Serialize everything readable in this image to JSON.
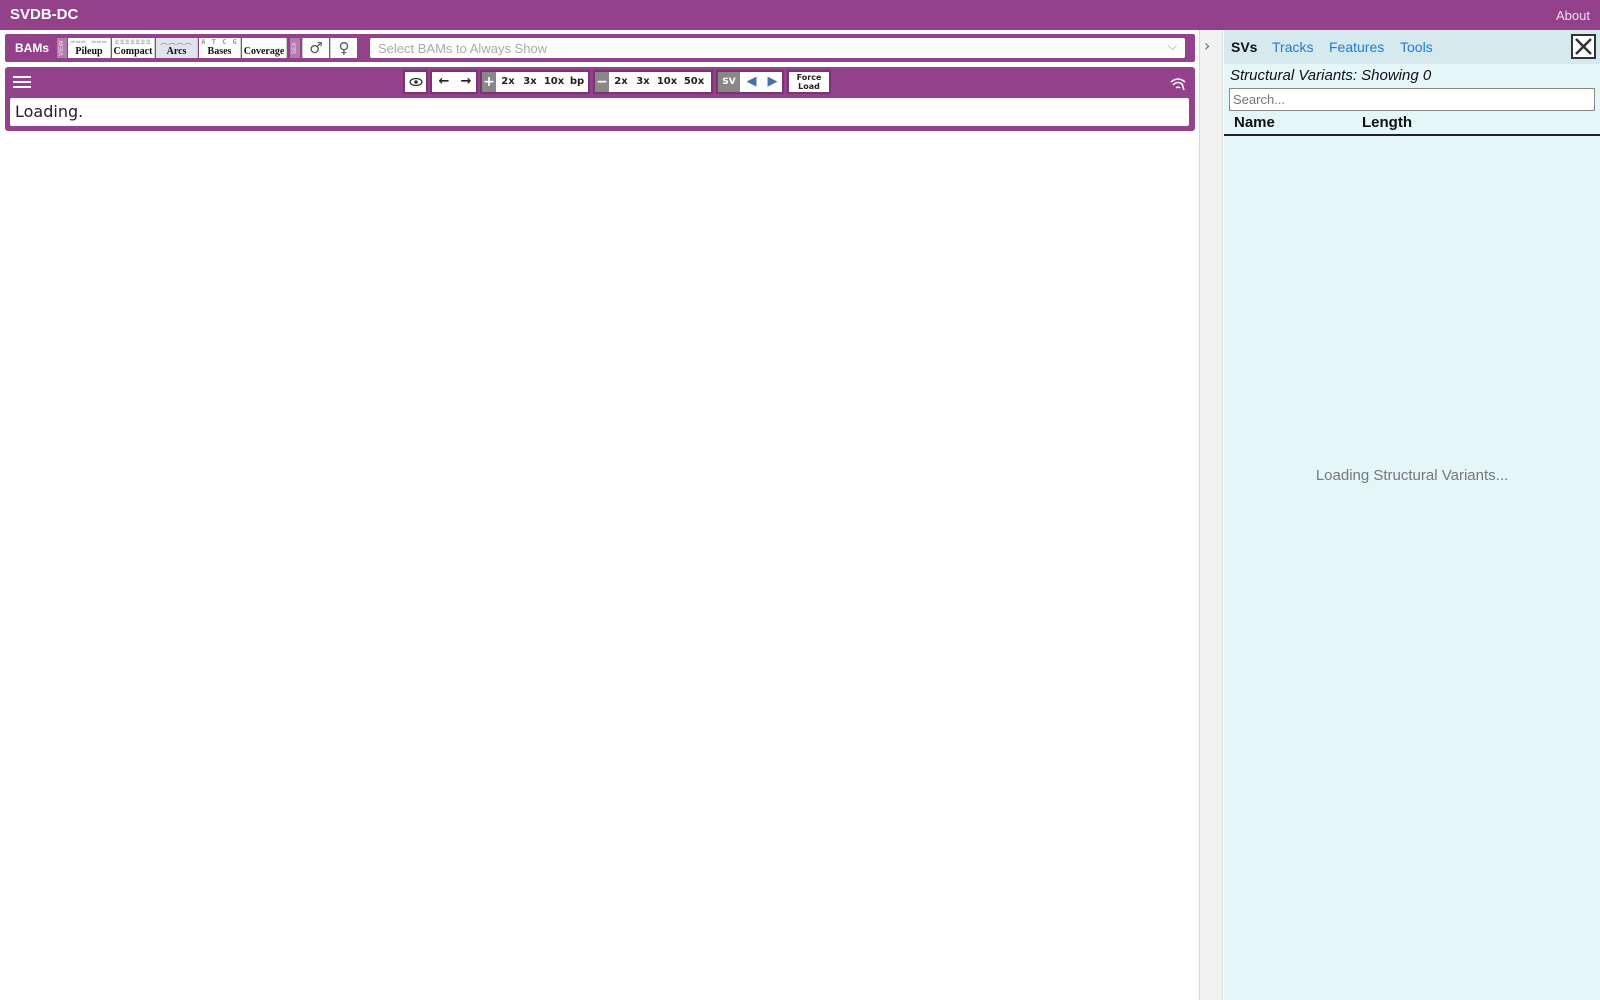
{
  "app": {
    "title": "SVDB-DC",
    "about_label": "About"
  },
  "bam_toolbar": {
    "bams_label": "BAMs",
    "view_tag": "VIEW",
    "sex_tag": "SEX",
    "views": [
      {
        "label": "Pileup",
        "glyph": "═══ ═══",
        "active": false
      },
      {
        "label": "Compact",
        "glyph": "≡≡≡≡≡≡≡",
        "active": false
      },
      {
        "label": "Arcs",
        "glyph": "︵︵︵︵",
        "active": true
      },
      {
        "label": "Bases",
        "glyph": "A T C G",
        "active": false
      },
      {
        "label": "Coverage",
        "glyph": "",
        "active": false
      }
    ],
    "male_symbol": "♂",
    "female_symbol": "♀",
    "select_placeholder": "Select BAMs to Always Show",
    "select_chevron": "⌵"
  },
  "viewer": {
    "nav": {
      "eye": "👁",
      "left": "←",
      "right": "→",
      "zoom_in_sign": "+",
      "zoom_in": [
        "2x",
        "3x",
        "10x",
        "bp"
      ],
      "zoom_out_sign": "−",
      "zoom_out": [
        "2x",
        "3x",
        "10x",
        "50x"
      ],
      "sv_label": "SV",
      "prev_sv": "◀",
      "next_sv": "▶",
      "force_load": [
        "Force",
        "Load"
      ]
    },
    "loading_text": "Loading."
  },
  "divider": {
    "collapse_glyph": "›"
  },
  "sidebar": {
    "tabs": [
      {
        "label": "SVs",
        "active": true
      },
      {
        "label": "Tracks",
        "active": false
      },
      {
        "label": "Features",
        "active": false
      },
      {
        "label": "Tools",
        "active": false
      }
    ],
    "header": "Structural Variants: Showing 0",
    "search_placeholder": "Search...",
    "columns": [
      "Name",
      "Length"
    ],
    "loading_text": "Loading Structural Variants..."
  },
  "colors": {
    "brand": "#94418c",
    "sidebar_bg": "#e4f6f7",
    "link": "#1e7bd6"
  }
}
